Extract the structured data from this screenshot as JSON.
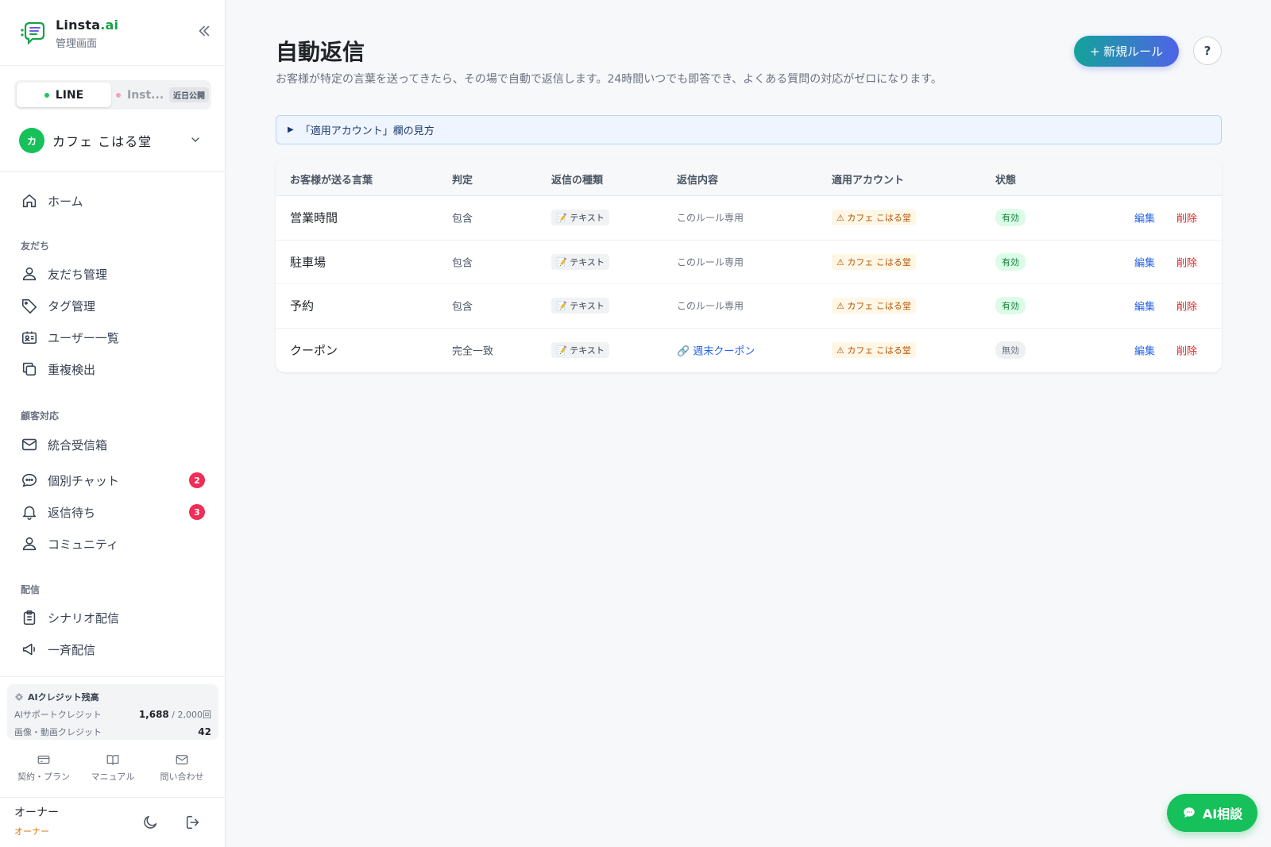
{
  "brand": {
    "name": "Linsta",
    "name_suffix": ".ai",
    "subtitle": "管理画面"
  },
  "channel_tabs": [
    {
      "label": "LINE",
      "active": true
    },
    {
      "label": "Inst...",
      "active": false,
      "badge": "近日公開"
    }
  ],
  "account": {
    "avatar": "カ",
    "name": "カフェ こはる堂"
  },
  "nav": {
    "home": "ホーム",
    "sections": {
      "friends": "友だち",
      "support": "顧客対応",
      "delivery": "配信"
    },
    "friends_items": [
      "友だち管理",
      "タグ管理",
      "ユーザー一覧",
      "重複検出"
    ],
    "support_items": [
      {
        "label": "統合受信箱"
      },
      {
        "label": "個別チャット",
        "badge": "2"
      },
      {
        "label": "返信待ち",
        "badge": "3"
      },
      {
        "label": "コミュニティ"
      }
    ],
    "delivery_items": [
      "シナリオ配信",
      "一斉配信"
    ]
  },
  "credits": {
    "title": "AIクレジット残高",
    "support_label": "AIサポートクレジット",
    "support_value": "1,688",
    "support_total": "/ 2,000回",
    "media_label": "画像・動画クレジット",
    "media_value": "42"
  },
  "footer_links": [
    "契約・プラン",
    "マニュアル",
    "問い合わせ"
  ],
  "user": {
    "name": "オーナー",
    "role": "オーナー"
  },
  "page": {
    "title": "自動返信",
    "description": "お客様が特定の言葉を送ってきたら、その場で自動で返信します。24時間いつでも即答でき、よくある質問の対応がゼロになります。",
    "new_rule_button": "+ 新規ルール",
    "help_button": "?",
    "info_bar": "「適用アカウント」欄の見方"
  },
  "table": {
    "headers": [
      "お客様が送る言葉",
      "判定",
      "返信の種類",
      "返信内容",
      "適用アカウント",
      "状態"
    ],
    "rows": [
      {
        "keyword": "営業時間",
        "match": "包含",
        "type": "📝 テキスト",
        "content": "このルール専用",
        "content_link": false,
        "account": "⚠ カフェ こはる堂",
        "status": "有効",
        "active": true,
        "edit": "編集",
        "delete": "削除"
      },
      {
        "keyword": "駐車場",
        "match": "包含",
        "type": "📝 テキスト",
        "content": "このルール専用",
        "content_link": false,
        "account": "⚠ カフェ こはる堂",
        "status": "有効",
        "active": true,
        "edit": "編集",
        "delete": "削除"
      },
      {
        "keyword": "予約",
        "match": "包含",
        "type": "📝 テキスト",
        "content": "このルール専用",
        "content_link": false,
        "account": "⚠ カフェ こはる堂",
        "status": "有効",
        "active": true,
        "edit": "編集",
        "delete": "削除"
      },
      {
        "keyword": "クーポン",
        "match": "完全一致",
        "type": "📝 テキスト",
        "content": "🔗 週末クーポン",
        "content_link": true,
        "account": "⚠ カフェ こはる堂",
        "status": "無効",
        "active": false,
        "edit": "編集",
        "delete": "削除"
      }
    ]
  },
  "ai_button": "AI相談"
}
